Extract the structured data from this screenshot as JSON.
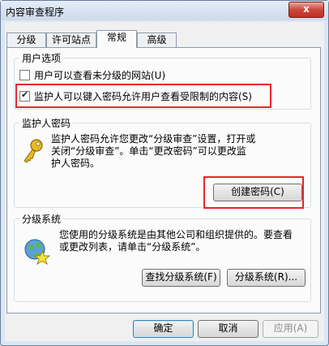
{
  "window": {
    "title": "内容审查程序",
    "close": "x"
  },
  "tabs": [
    {
      "label": "分级"
    },
    {
      "label": "许可站点"
    },
    {
      "label": "常规"
    },
    {
      "label": "高级"
    }
  ],
  "user_options": {
    "label": "用户选项",
    "view_unrated": {
      "label": "用户可以查看未分级的网站(U)",
      "checked": false
    },
    "supervisor_password": {
      "label": "监护人可以键入密码允许用户查看受限制的内容(S)",
      "checked": true
    }
  },
  "supervisor": {
    "label": "监护人密码",
    "text": [
      "监护人密码允许您更改“分级审查”设置，打开或",
      "关闭“分级审查”。单击“更改密码”可以更改监",
      "护人密码。"
    ],
    "icon": "key-icon",
    "create_button": "创建密码(C)"
  },
  "rating_systems": {
    "label": "分级系统",
    "text": [
      "您使用的分级系统是由其他公司和组织提供的。要查看",
      "或更改列表，请单击“分级系统”。"
    ],
    "icon": "certificate-icon",
    "find_button": "查找分级系统(F)",
    "systems_button": "分级系统(R)..."
  },
  "footer": {
    "ok": "确定",
    "cancel": "取消",
    "apply": "应用(A)"
  },
  "highlight_color": "#e8262c"
}
